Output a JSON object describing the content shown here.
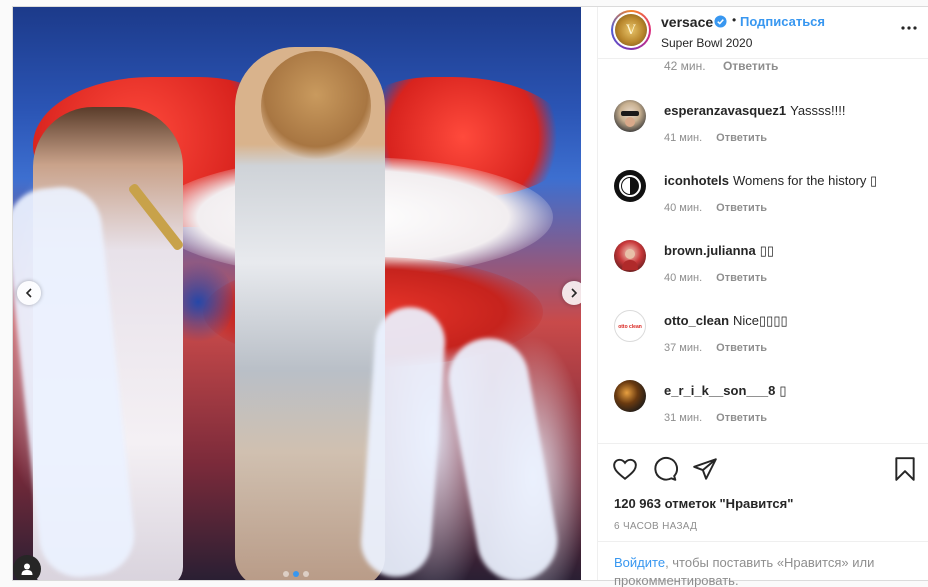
{
  "owner": {
    "username": "versace",
    "follow_label": "Подписаться",
    "separator": "•",
    "location": "Super Bowl 2020",
    "avatar_text": "V"
  },
  "partial_comment": {
    "time": "42 мин.",
    "reply_label": "Ответить"
  },
  "comments": [
    {
      "username": "esperanzavasquez1",
      "text": "Yassss!!!!",
      "time": "41 мин.",
      "reply_label": "Ответить"
    },
    {
      "username": "iconhotels",
      "text": "Womens for the history ▯",
      "time": "40 мин.",
      "reply_label": "Ответить"
    },
    {
      "username": "brown.julianna",
      "text": "▯▯",
      "time": "40 мин.",
      "reply_label": "Ответить"
    },
    {
      "username": "otto_clean",
      "text": "Nice▯▯▯▯",
      "time": "37 мин.",
      "reply_label": "Ответить"
    },
    {
      "username": "e_r_i_k__son___8",
      "text": "▯",
      "time": "31 мин.",
      "reply_label": "Ответить"
    }
  ],
  "actions": {
    "like_icon": "heart-icon",
    "comment_icon": "comment-icon",
    "share_icon": "share-icon",
    "save_icon": "bookmark-icon"
  },
  "likes_text": "120 963 отметок \"Нравится\"",
  "posted_ago": "6 ЧАСОВ НАЗАД",
  "login_prompt": {
    "link": "Войдите",
    "rest": ", чтобы поставить «Нравится» или прокомментировать."
  },
  "otto_avatar_text": "otto clean",
  "carousel": {
    "total": 3,
    "active": 1
  },
  "colors": {
    "link_blue": "#3897f0",
    "text": "#262626",
    "muted": "#8e8e8e",
    "border": "#dbdbdb"
  }
}
